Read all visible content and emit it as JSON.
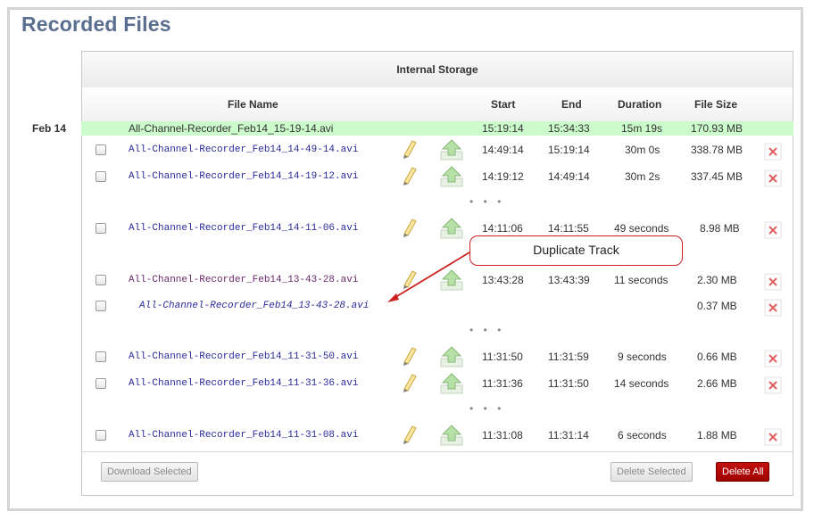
{
  "page": {
    "title": "Recorded Files"
  },
  "storage": {
    "label": "Internal Storage"
  },
  "columns": {
    "file_name": "File Name",
    "start": "Start",
    "end": "End",
    "duration": "Duration",
    "file_size": "File Size"
  },
  "date_group": "Feb 14",
  "ellipsis": "• • •",
  "rows": [
    {
      "name": "All-Channel-Recorder_Feb14_15-19-14.avi",
      "start": "15:19:14",
      "end": "15:34:33",
      "duration": "15m 19s",
      "size": "170.93 MB",
      "state": "recording"
    },
    {
      "name": "All-Channel-Recorder_Feb14_14-49-14.avi",
      "start": "14:49:14",
      "end": "15:19:14",
      "duration": "30m 0s",
      "size": "338.78 MB",
      "state": "normal"
    },
    {
      "name": "All-Channel-Recorder_Feb14_14-19-12.avi",
      "start": "14:19:12",
      "end": "14:49:14",
      "duration": "30m 2s",
      "size": "337.45 MB",
      "state": "normal"
    },
    {
      "name": "All-Channel-Recorder_Feb14_14-11-06.avi",
      "start": "14:11:06",
      "end": "14:11:55",
      "duration": "49 seconds",
      "size": "8.98 MB",
      "state": "normal"
    },
    {
      "name": "All-Channel-Recorder_Feb14_13-43-28.avi",
      "start": "13:43:28",
      "end": "13:43:39",
      "duration": "11 seconds",
      "size": "2.30 MB",
      "state": "visited"
    },
    {
      "name": "All-Channel-Recorder_Feb14_13-43-28.avi",
      "start": "",
      "end": "",
      "duration": "",
      "size": "0.37 MB",
      "state": "duplicate"
    },
    {
      "name": "All-Channel-Recorder_Feb14_11-31-50.avi",
      "start": "11:31:50",
      "end": "11:31:59",
      "duration": "9 seconds",
      "size": "0.66 MB",
      "state": "normal"
    },
    {
      "name": "All-Channel-Recorder_Feb14_11-31-36.avi",
      "start": "11:31:36",
      "end": "11:31:50",
      "duration": "14 seconds",
      "size": "2.66 MB",
      "state": "normal"
    },
    {
      "name": "All-Channel-Recorder_Feb14_11-31-08.avi",
      "start": "11:31:08",
      "end": "11:31:14",
      "duration": "6 seconds",
      "size": "1.88 MB",
      "state": "normal"
    }
  ],
  "icons": {
    "rename": "pencil-icon",
    "upload": "upload-arrow-icon",
    "delete": "delete-x-icon"
  },
  "buttons": {
    "download_selected": "Download Selected",
    "delete_selected": "Delete Selected",
    "delete_all": "Delete All"
  },
  "callout": {
    "text": "Duplicate Track"
  },
  "colors": {
    "title": "#5a6e8f",
    "highlight_row": "#ccfbcc",
    "danger": "#a00000",
    "callout_border": "#cc2222"
  }
}
